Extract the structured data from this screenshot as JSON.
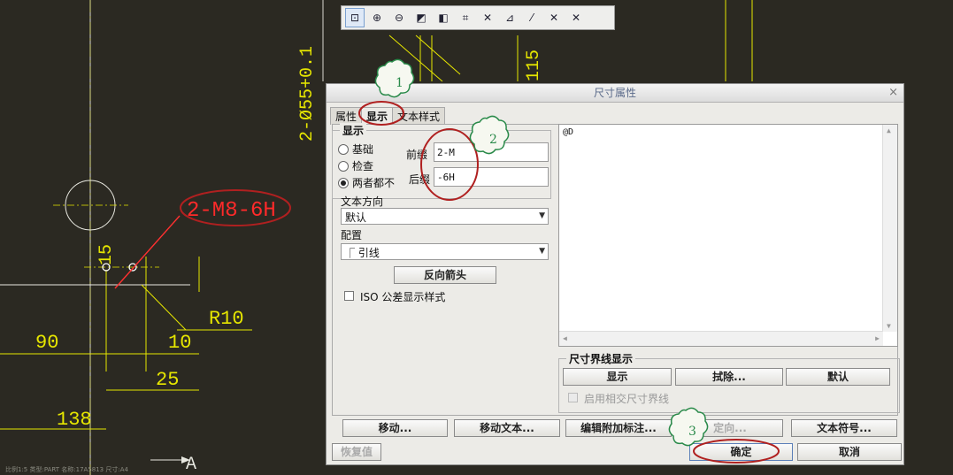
{
  "cad": {
    "labels": {
      "thread": "2-M8-6H",
      "diameter": "2-Ø55+0.1",
      "dim_15": "15",
      "dim_r10": "R10",
      "dim_90": "90",
      "dim_10": "10",
      "dim_25": "25",
      "dim_138": "138",
      "dim_115": "115",
      "section_letter": "A"
    },
    "status_bar": "比例1:5    类型:PART    名称:17A5813    尺寸:A4"
  },
  "toolbar": {
    "buttons": [
      "zoom-fit",
      "zoom-in",
      "zoom-out",
      "repaint",
      "view-orient",
      "annotation",
      "datum-display-1",
      "datum-display-2",
      "datum-display-3",
      "datum-display-4",
      "datum-display-5"
    ]
  },
  "dialog": {
    "title": "尺寸属性",
    "close": "×",
    "tabs": [
      "属性",
      "显示",
      "文本样式"
    ],
    "display_group": {
      "title": "显示",
      "options": [
        "基础",
        "检查",
        "两者都不"
      ],
      "selected": "两者都不"
    },
    "prefix": {
      "label": "前缀",
      "value": "2-M"
    },
    "suffix": {
      "label": "后缀",
      "value": "-6H"
    },
    "text_direction": {
      "label": "文本方向",
      "value": "默认"
    },
    "placement": {
      "label": "配置",
      "value": "引线"
    },
    "reverse_arrow": "反向箭头",
    "iso_checkbox": "ISO 公差显示样式",
    "text_content": "@D",
    "extension_group": {
      "title": "尺寸界线显示",
      "show": "显示",
      "erase": "拭除...",
      "default": "默认",
      "intersect_checkbox": "启用相交尺寸界线"
    },
    "bottom_buttons": {
      "move": "移动...",
      "move_text": "移动文本...",
      "edit_attach": "编辑附加标注...",
      "orient": "定向...",
      "text_symbol": "文本符号..."
    },
    "restore": "恢复值",
    "ok": "确定",
    "cancel": "取消"
  },
  "callouts": [
    "1",
    "2",
    "3"
  ],
  "colors": {
    "cad_bg": "#2b2922",
    "cad_line": "#e6e600",
    "highlight_red": "#b02020",
    "callout_green": "#2a8a4a"
  }
}
